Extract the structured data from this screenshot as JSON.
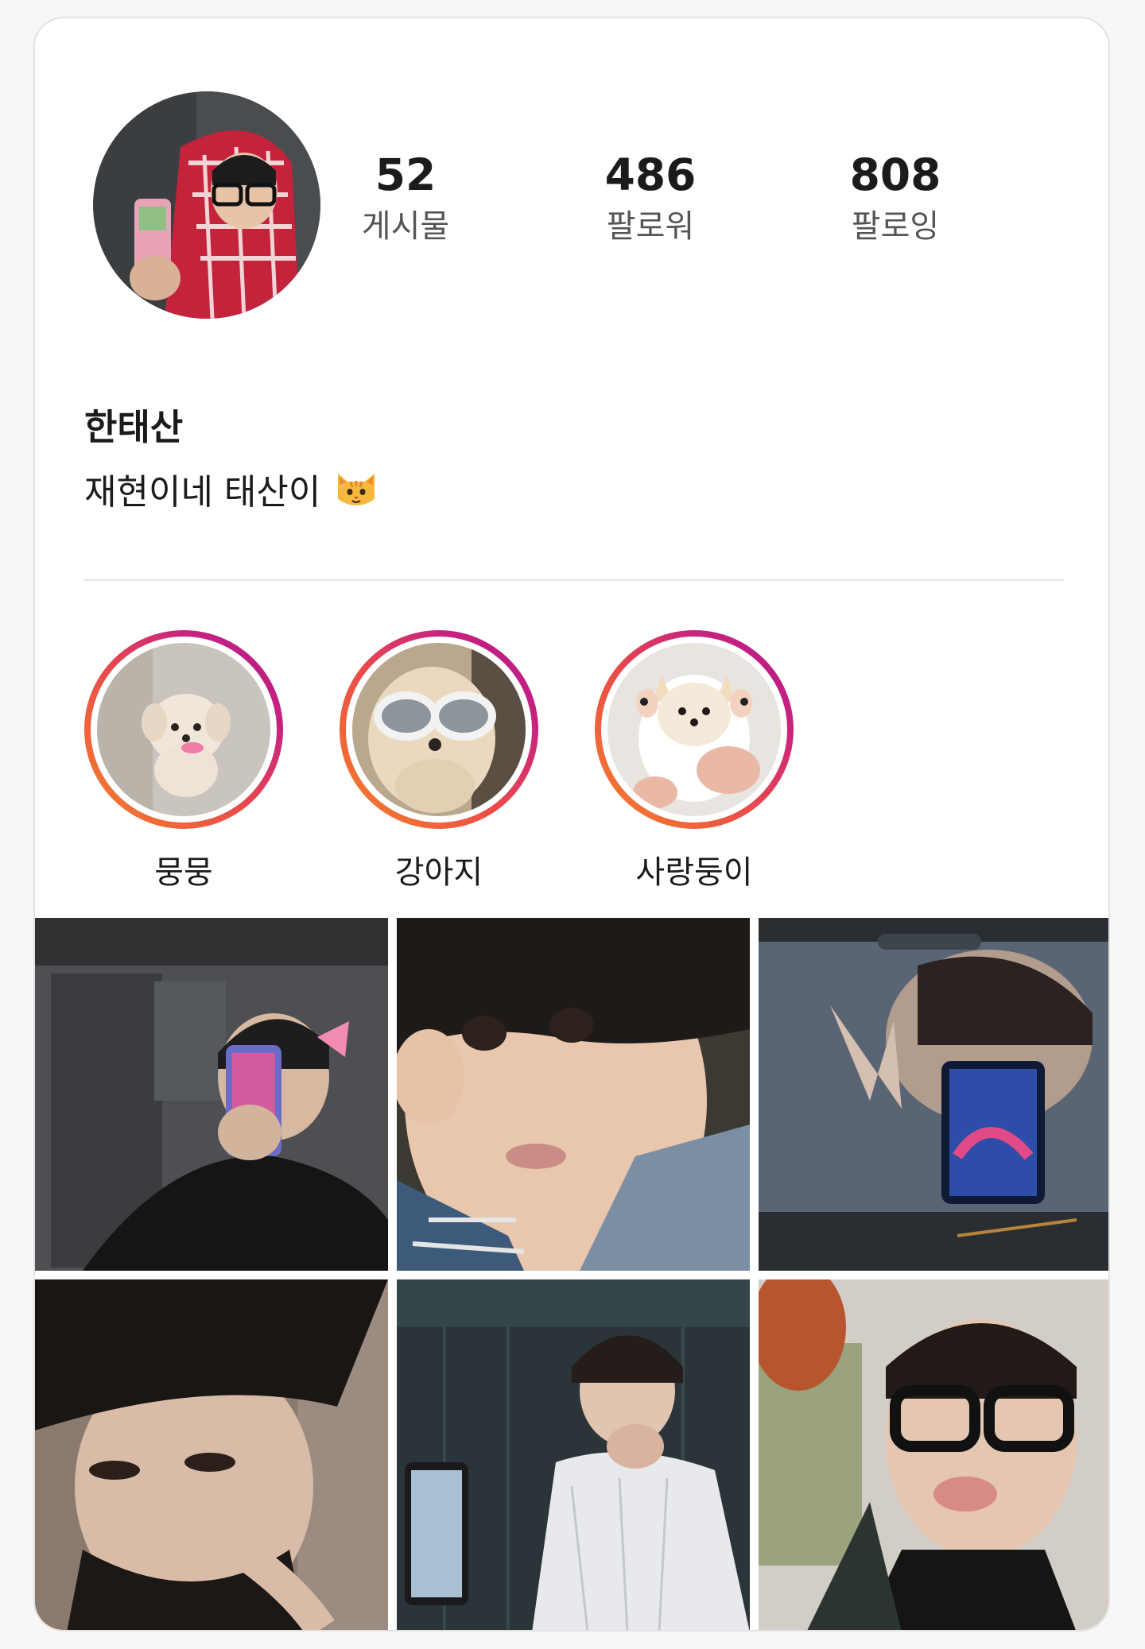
{
  "profile": {
    "name": "한태산",
    "bio": "재현이네 태산이"
  },
  "stats": [
    {
      "value": "52",
      "label": "게시물"
    },
    {
      "value": "486",
      "label": "팔로워"
    },
    {
      "value": "808",
      "label": "팔로잉"
    }
  ],
  "highlights": [
    {
      "label": "뭉뭉"
    },
    {
      "label": "강아지"
    },
    {
      "label": "사랑둥이"
    }
  ],
  "icons": {
    "bio_emoji": "cat-face-icon"
  },
  "colors": {
    "story_ring_start": "#f58529",
    "story_ring_end": "#b0168a"
  }
}
